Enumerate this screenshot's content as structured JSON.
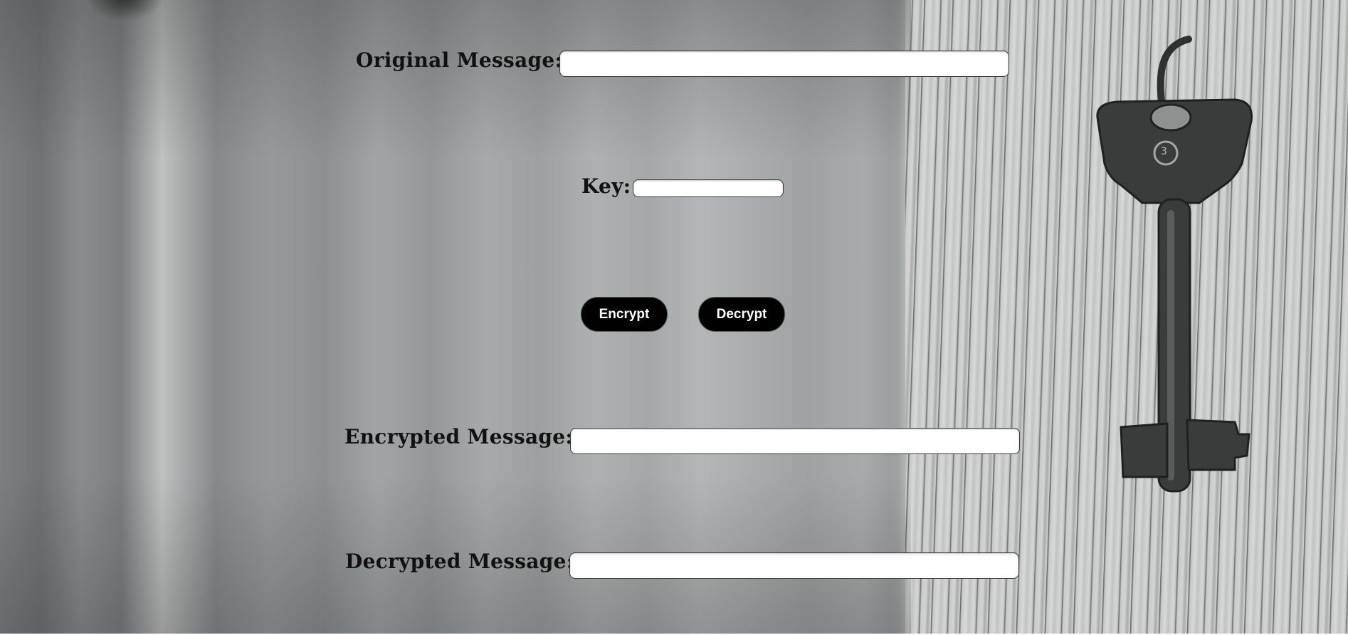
{
  "form": {
    "original": {
      "label": "Original Message:",
      "value": "",
      "placeholder": ""
    },
    "key": {
      "label": "Key:",
      "value": "",
      "placeholder": ""
    },
    "encrypted": {
      "label": "Encrypted Message:",
      "value": "",
      "placeholder": ""
    },
    "decrypted": {
      "label": "Decrypted Message:",
      "value": "",
      "placeholder": ""
    }
  },
  "buttons": {
    "encrypt_label": "Encrypt",
    "decrypt_label": "Decrypt"
  },
  "background": {
    "subject": "key-on-wooden-plank-photo"
  },
  "colors": {
    "button_bg": "#000000",
    "button_text": "#ffffff",
    "label_text": "#111111",
    "field_bg": "#ffffff"
  }
}
